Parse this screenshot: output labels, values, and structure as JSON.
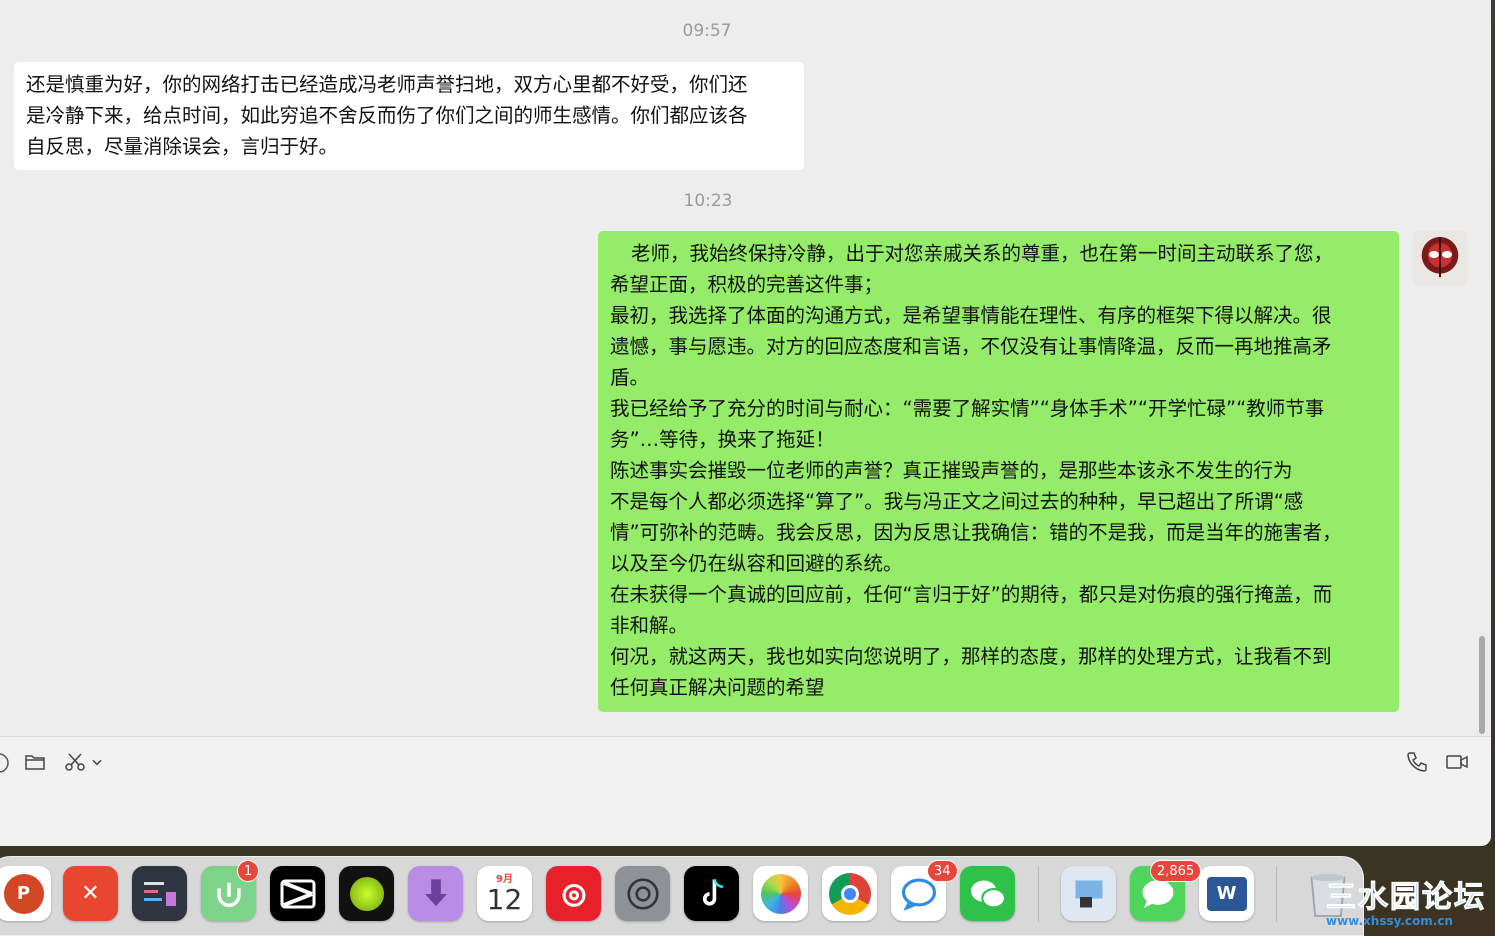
{
  "messages": {
    "time_1": "09:57",
    "incoming_1": [
      "还是慎重为好，你的网络打击已经造成冯老师声誉扫地，双方心里都不好受，你们还",
      "是冷静下来，给点时间，如此穷追不舍反而伤了你们之间的师生感情。你们都应该各",
      "自反思，尽量消除误会，言归于好。"
    ],
    "time_2": "10:23",
    "outgoing_1": [
      "老师，我始终保持冷静，出于对您亲戚关系的尊重，也在第一时间主动联系了您，",
      "希望正面，积极的完善这件事；",
      "最初，我选择了体面的沟通方式，是希望事情能在理性、有序的框架下得以解决。很",
      "遗憾，事与愿违。对方的回应态度和言语，不仅没有让事情降温，反而一再地推高矛",
      "盾。",
      "我已经给予了充分的时间与耐心：“需要了解实情”“身体手术”“开学忙碌”“教师节事",
      "务”…等待，换来了拖延！",
      "陈述事实会摧毁一位老师的声誉？真正摧毁声誉的，是那些本该永不发生的行为",
      "不是每个人都必须选择“算了”。我与冯正文之间过去的种种，早已超出了所谓“感",
      "情”可弥补的范畴。我会反思，因为反思让我确信：错的不是我，而是当年的施害者，",
      "以及至今仍在纵容和回避的系统。",
      "在未获得一个真诚的回应前，任何“言归于好”的期待，都只是对伤痕的强行掩盖，而",
      "非和解。",
      "何况，就这两天，我也如实向您说明了，那样的态度，那样的处理方式，让我看不到",
      "任何真正解决问题的希望"
    ]
  },
  "toolbar": {
    "icons": [
      "folder-icon",
      "scissors-icon",
      "chevron-down-icon",
      "phone-icon",
      "video-icon"
    ]
  },
  "dock": {
    "badges": {
      "mi_home": "1",
      "calendar_month": "9月",
      "calendar_day": "12",
      "messenger": "34",
      "messages": "2,865"
    },
    "apps": [
      "PowerPoint",
      "XMind",
      "Tencent Docs",
      "Mi Home",
      "CapCut",
      "Camo",
      "Downie",
      "Calendar",
      "NetEase Music",
      "System Settings",
      "TikTok",
      "Photos",
      "Chrome",
      "Messenger",
      "WeChat",
      "Preview",
      "Messages",
      "Word",
      "Trash"
    ]
  },
  "watermark": {
    "main": "三水园论坛",
    "sub": "www.xhssy.com.cn"
  },
  "colors": {
    "window_bg": "#ededed",
    "incoming_bubble": "#ffffff",
    "outgoing_bubble": "#95ec69",
    "timestamp": "#9a9a9a"
  }
}
